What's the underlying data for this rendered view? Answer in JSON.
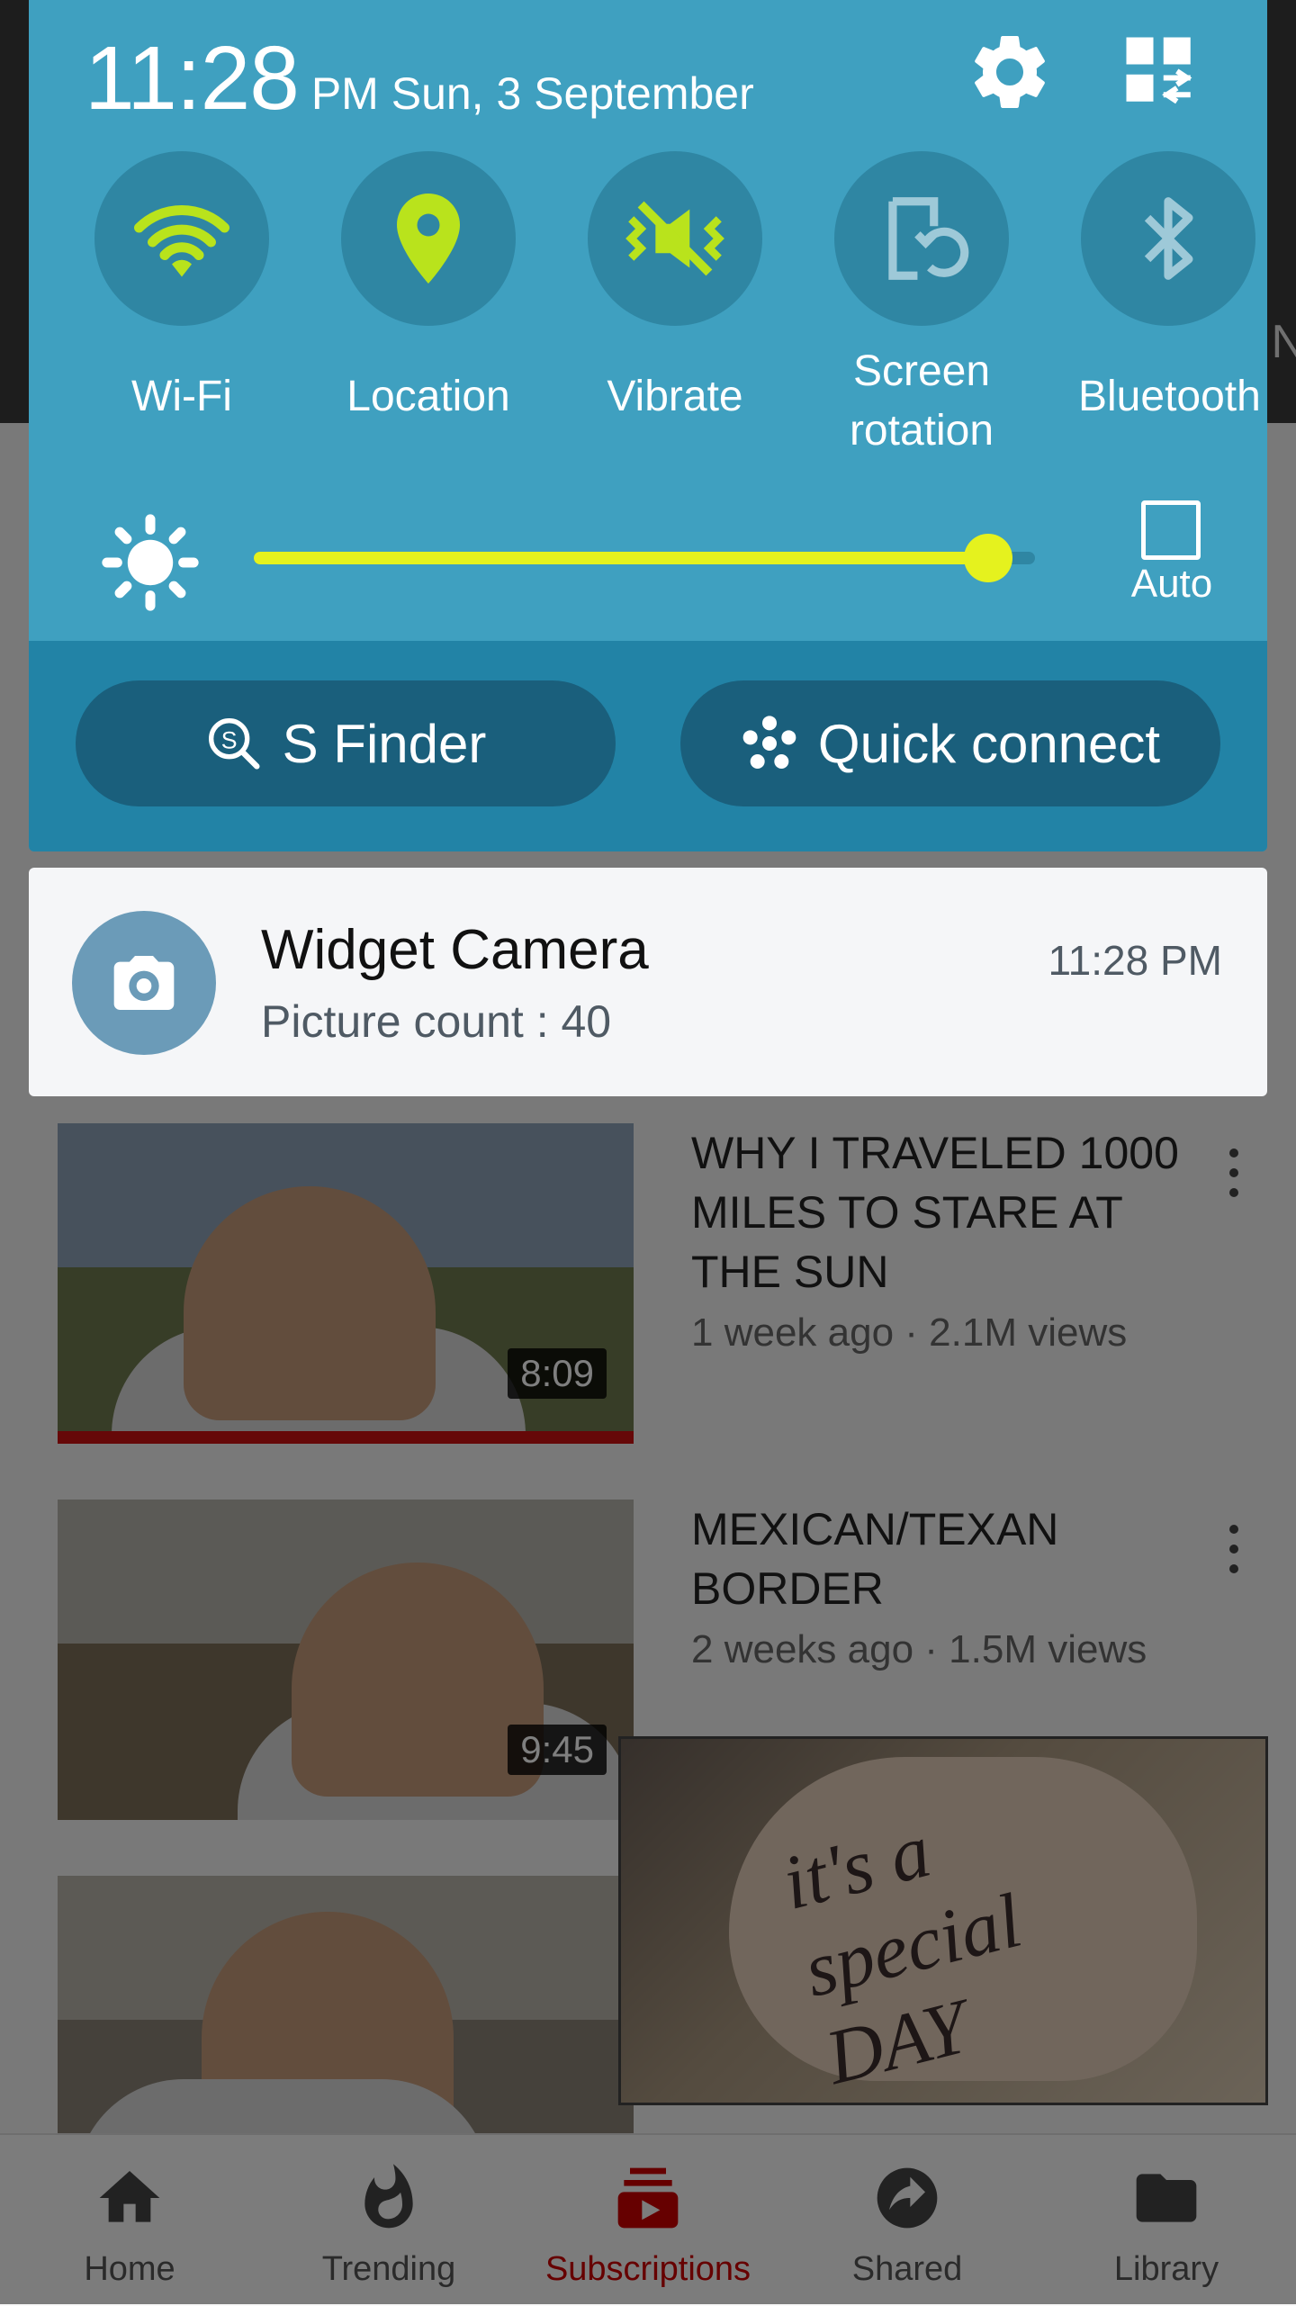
{
  "status": {
    "time": "11:28",
    "date_suffix": "PM Sun, 3 September"
  },
  "quick_toggles": [
    {
      "label": "Wi-Fi",
      "icon": "wifi-icon",
      "active": true
    },
    {
      "label": "Location",
      "icon": "location-icon",
      "active": true
    },
    {
      "label": "Vibrate",
      "icon": "vibrate-icon",
      "active": true
    },
    {
      "label_line1": "Screen",
      "label_line2": "rotation",
      "icon": "screen-rotation-icon",
      "active": false
    },
    {
      "label": "Bluetooth",
      "icon": "bluetooth-icon",
      "active": false
    }
  ],
  "brightness": {
    "level": 0.94,
    "auto_label": "Auto",
    "auto_checked": false
  },
  "shade_buttons": {
    "s_finder": "S Finder",
    "quick_connect": "Quick connect"
  },
  "notification": {
    "app": "Widget Camera",
    "text": "Picture count : 40",
    "time": "11:28 PM"
  },
  "videos": [
    {
      "title": "WHY I TRAVELED 1000 MILES TO STARE AT THE SUN",
      "meta": "1 week ago · 2.1M views",
      "duration": "8:09"
    },
    {
      "title": "MEXICAN/TEXAN BORDER",
      "meta": "2 weeks ago · 1.5M views",
      "duration": "9:45"
    }
  ],
  "miniplayer": {
    "caption": "it's a special DAY"
  },
  "bottom_nav": [
    {
      "label": "Home",
      "icon": "home-icon"
    },
    {
      "label": "Trending",
      "icon": "trending-icon"
    },
    {
      "label": "Subscriptions",
      "icon": "subscriptions-icon",
      "active": true
    },
    {
      "label": "Shared",
      "icon": "shared-icon"
    },
    {
      "label": "Library",
      "icon": "library-icon"
    }
  ],
  "colors": {
    "shade": "#3fa0c0",
    "accent": "#e5f21e",
    "active_nav": "#cc0000"
  }
}
